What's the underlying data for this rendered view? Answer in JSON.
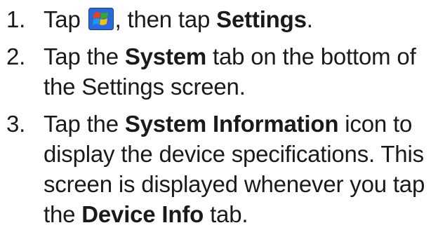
{
  "steps": [
    {
      "number": "1.",
      "text_1": "Tap",
      "icon": "windows-start-icon",
      "text_2": ", then tap",
      "bold_1": "Settings",
      "text_3": "."
    },
    {
      "number": "2.",
      "text_1": "Tap the",
      "bold_1": "System",
      "text_2": "tab on the bottom of the Settings screen."
    },
    {
      "number": "3.",
      "text_1": "Tap the",
      "bold_1": "System Information",
      "text_2": "icon to display the device specifications. This screen is displayed whenever you tap the",
      "bold_2": "Device Info",
      "text_3": "tab."
    }
  ],
  "colors": {
    "text": "#1a1a1a",
    "icon_red": "#e8401c",
    "icon_green": "#3aa52a",
    "icon_blue": "#1f5fd6",
    "icon_yellow": "#f5c21b",
    "icon_bg": "#2a6ad8"
  }
}
